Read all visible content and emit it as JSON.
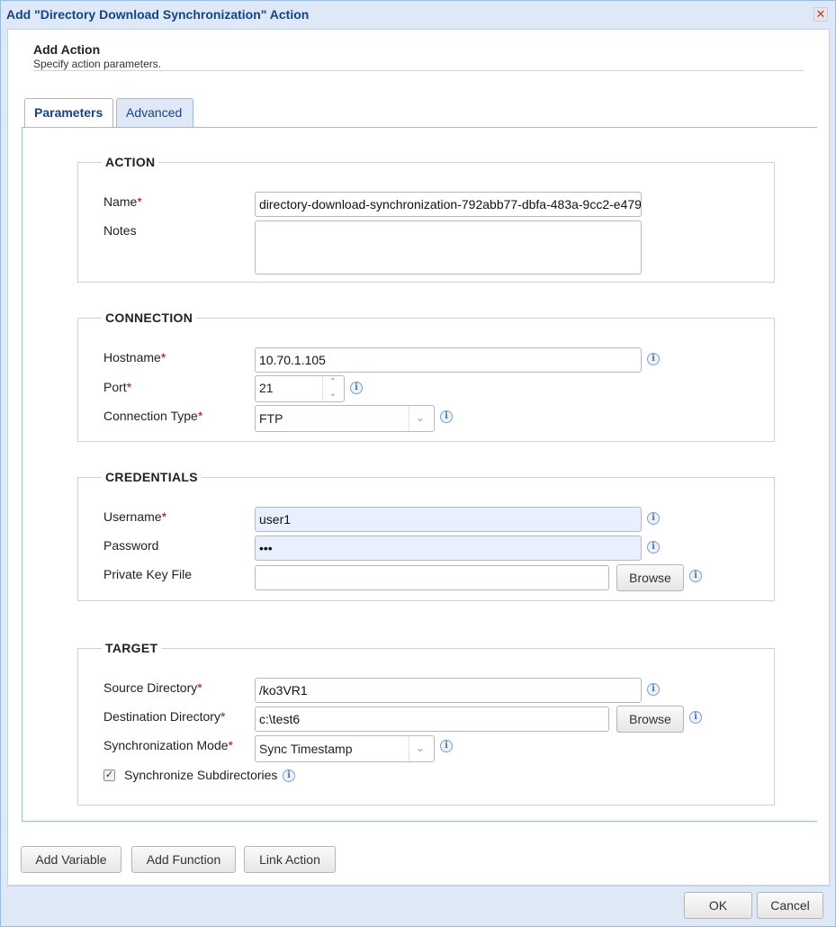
{
  "window": {
    "title": "Add \"Directory Download Synchronization\" Action"
  },
  "header": {
    "title": "Add Action",
    "subtitle": "Specify action parameters."
  },
  "tabs": [
    {
      "label": "Parameters"
    },
    {
      "label": "Advanced"
    }
  ],
  "action": {
    "legend": "ACTION",
    "name_label": "Name",
    "name_value": "directory-download-synchronization-792abb77-dbfa-483a-9cc2-e479",
    "notes_label": "Notes",
    "notes_value": ""
  },
  "connection": {
    "legend": "CONNECTION",
    "hostname_label": "Hostname",
    "hostname_value": "10.70.1.105",
    "port_label": "Port",
    "port_value": "21",
    "type_label": "Connection Type",
    "type_value": "FTP"
  },
  "credentials": {
    "legend": "CREDENTIALS",
    "username_label": "Username",
    "username_value": "user1",
    "password_label": "Password",
    "password_value": "•••",
    "keyfile_label": "Private Key File",
    "keyfile_value": "",
    "browse_label": "Browse"
  },
  "target": {
    "legend": "TARGET",
    "source_label": "Source Directory",
    "source_value": "/ko3VR1",
    "dest_label": "Destination Directory",
    "dest_value": "c:\\test6",
    "browse_label": "Browse",
    "mode_label": "Synchronization Mode",
    "mode_value": "Sync Timestamp",
    "subdirs_label": "Synchronize Subdirectories",
    "subdirs_checked": true
  },
  "toolbar": {
    "add_variable": "Add Variable",
    "add_function": "Add Function",
    "link_action": "Link Action"
  },
  "footer": {
    "ok": "OK",
    "cancel": "Cancel"
  },
  "required_marker": "*",
  "info_glyph": "i"
}
